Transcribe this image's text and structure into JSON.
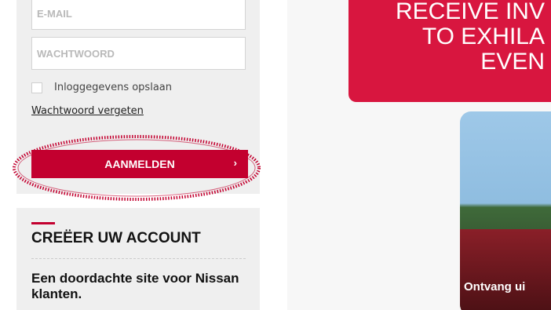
{
  "login": {
    "email_placeholder": "E-MAIL",
    "password_placeholder": "WACHTWOORD",
    "remember_label": "Inloggegevens opslaan",
    "forgot_link": "Wachtwoord vergeten",
    "login_button": "AANMELDEN",
    "login_chevron": "›"
  },
  "account": {
    "title": "CREËER UW ACCOUNT",
    "description": "Een doordachte site voor Nissan klanten."
  },
  "hero": {
    "promo_line1": "RECEIVE INV",
    "promo_line2": "TO EXHILA",
    "promo_line3": "EVEN",
    "photo_caption": "Ontvang ui"
  },
  "colors": {
    "brand": "#c3002f",
    "panel": "#efefef",
    "highlight": "#c3002f"
  }
}
